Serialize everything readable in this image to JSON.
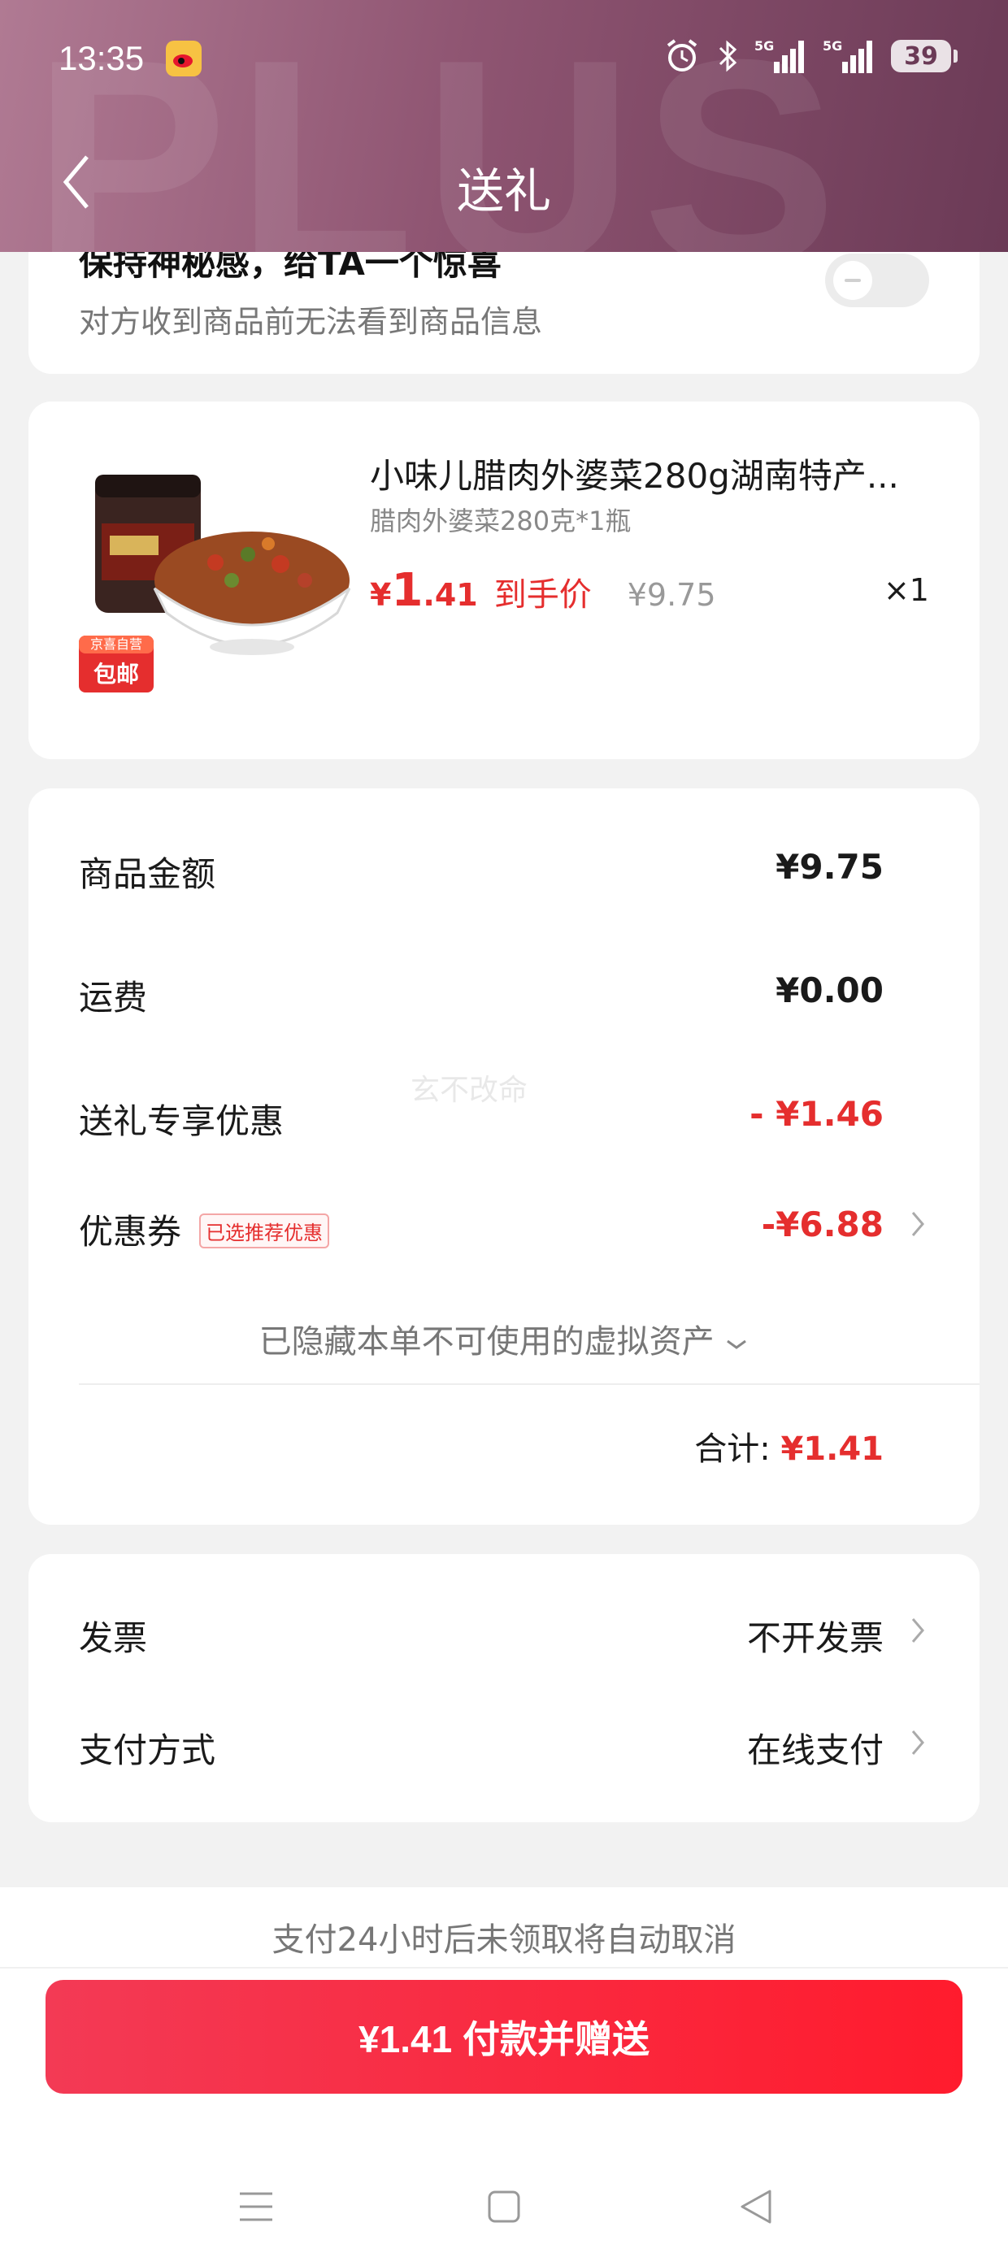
{
  "status_bar": {
    "time": "13:35",
    "battery": "39",
    "icons": [
      "weibo-icon",
      "alarm-icon",
      "bluetooth-icon",
      "signal-5g-icon",
      "signal-5g-icon",
      "battery-icon"
    ]
  },
  "header": {
    "title": "送礼",
    "background_text": "PLUS"
  },
  "secret": {
    "title": "保持神秘感，给TA一个惊喜",
    "subtitle": "对方收到商品前无法看到商品信息",
    "toggle_on": false
  },
  "product": {
    "name": "小味儿腊肉外婆菜280g湖南特产...",
    "spec": "腊肉外婆菜280克*1瓶",
    "price_symbol": "¥",
    "price_int": "1",
    "price_dec": ".41",
    "price_tag": "到手价",
    "original_price": "¥9.75",
    "quantity": "×1",
    "image_badge_top": "京喜自营",
    "image_badge_bottom": "包邮"
  },
  "amounts": {
    "goods_label": "商品金额",
    "goods_value": "¥9.75",
    "shipping_label": "运费",
    "shipping_value": "¥0.00",
    "gift_discount_label": "送礼专享优惠",
    "gift_discount_value": "- ¥1.46",
    "coupon_label": "优惠券",
    "coupon_badge": "已选推荐优惠",
    "coupon_value": "-¥6.88",
    "hidden_assets": "已隐藏本单不可使用的虚拟资产",
    "total_label": "合计:",
    "total_value": "¥1.41"
  },
  "watermark_user": "玄不改命",
  "payment": {
    "invoice_label": "发票",
    "invoice_value": "不开发票",
    "method_label": "支付方式",
    "method_value": "在线支付"
  },
  "footer": {
    "notice": "支付24小时后未领取将自动取消",
    "pay_button": "¥1.41 付款并赠送"
  },
  "colors": {
    "accent_red": "#e52e2e",
    "header_purple": "#8f5572",
    "button_red": "#ff1b2d"
  }
}
